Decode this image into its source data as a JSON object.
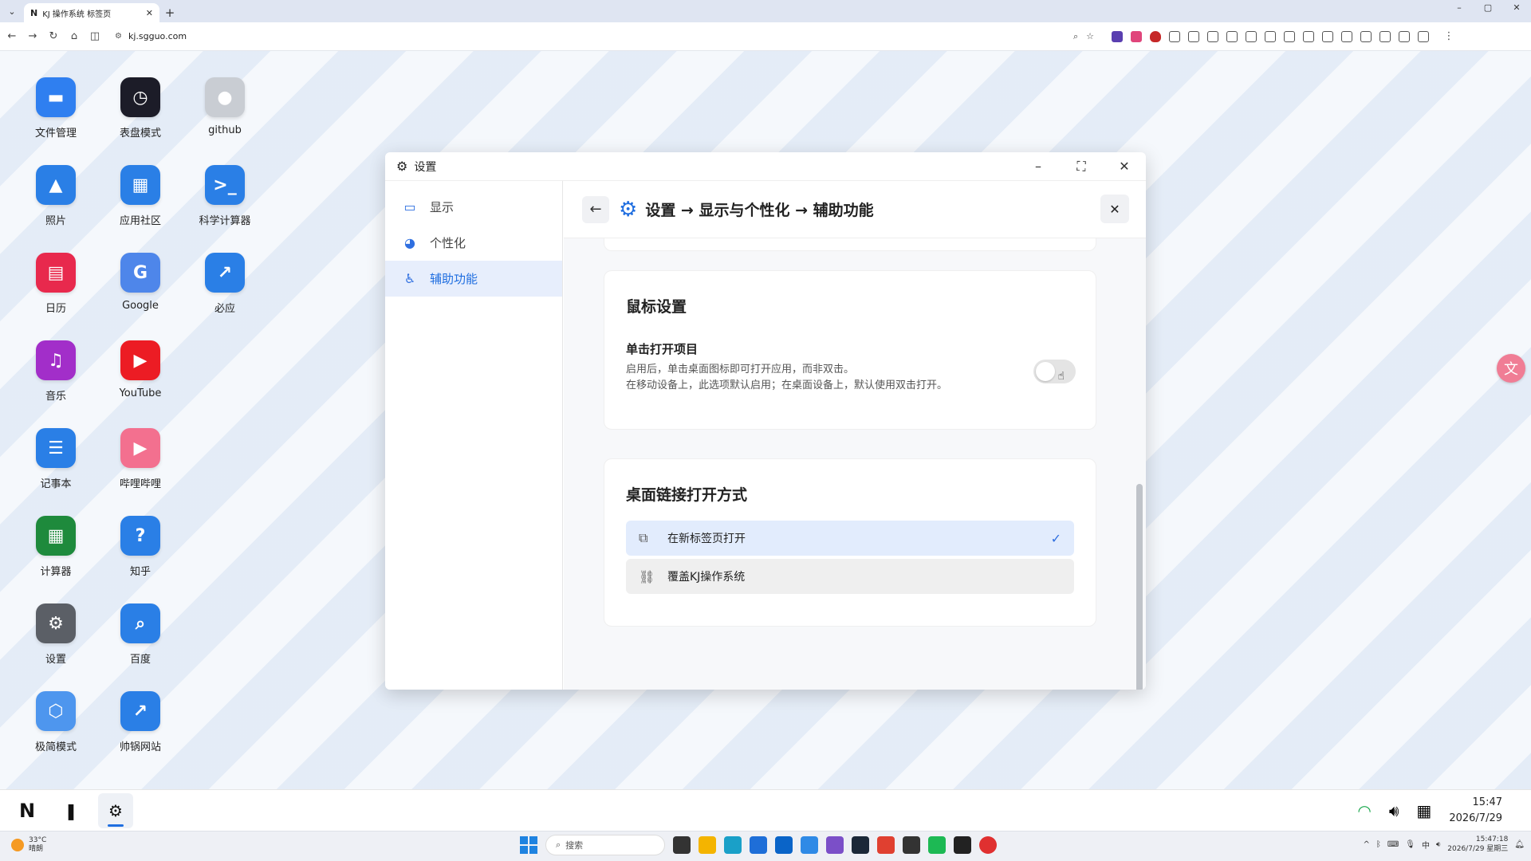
{
  "browser": {
    "tab_title": "KJ 操作系统 标签页",
    "tab_favicon": "N",
    "url": "kj.sgguo.com",
    "new_tab": "+",
    "win_min": "–",
    "win_max": "▢",
    "win_close": "✕"
  },
  "desktop_apps": [
    {
      "label": "文件管理",
      "icon": "folder-icon",
      "color": "#2f7ff0",
      "glyph": "▬"
    },
    {
      "label": "表盘模式",
      "icon": "clock-icon",
      "color": "#1c1c28",
      "glyph": "◷"
    },
    {
      "label": "github",
      "icon": "github-icon",
      "color": "#c9cdd3",
      "glyph": "●"
    },
    {
      "label": "照片",
      "icon": "photos-icon",
      "color": "#2a7fe6",
      "glyph": "▲"
    },
    {
      "label": "应用社区",
      "icon": "store-icon",
      "color": "#2a7fe6",
      "glyph": "▦"
    },
    {
      "label": "科学计算器",
      "icon": "terminal-icon",
      "color": "#2a7fe6",
      "glyph": ">_"
    },
    {
      "label": "日历",
      "icon": "calendar-icon",
      "color": "#e8294d",
      "glyph": "▤"
    },
    {
      "label": "Google",
      "icon": "google-icon",
      "color": "#4e86ea",
      "glyph": "G"
    },
    {
      "label": "必应",
      "icon": "external-link-icon",
      "color": "#2a7fe6",
      "glyph": "↗"
    },
    {
      "label": "音乐",
      "icon": "music-icon",
      "color": "#a22ec9",
      "glyph": "♫"
    },
    {
      "label": "YouTube",
      "icon": "youtube-icon",
      "color": "#ec1c24",
      "glyph": "▶"
    },
    {
      "label": "记事本",
      "icon": "notepad-icon",
      "color": "#2a7fe6",
      "glyph": "☰"
    },
    {
      "label": "哔哩哔哩",
      "icon": "bilibili-icon",
      "color": "#f3708f",
      "glyph": "▶"
    },
    {
      "label": "计算器",
      "icon": "calculator-icon",
      "color": "#1e8a3c",
      "glyph": "▦"
    },
    {
      "label": "知乎",
      "icon": "zhihu-icon",
      "color": "#2a7fe6",
      "glyph": "?"
    },
    {
      "label": "设置",
      "icon": "settings-icon",
      "color": "#5b5f66",
      "glyph": "⚙"
    },
    {
      "label": "百度",
      "icon": "search-icon",
      "color": "#2a7fe6",
      "glyph": "⌕"
    },
    {
      "label": "极简模式",
      "icon": "cube-icon",
      "color": "#4e96ee",
      "glyph": "⬡"
    },
    {
      "label": "帅锅网站",
      "icon": "external-link-icon",
      "color": "#2a7fe6",
      "glyph": "↗"
    }
  ],
  "settings": {
    "title": "设置",
    "sidebar": [
      {
        "label": "显示",
        "icon": "monitor-icon"
      },
      {
        "label": "个性化",
        "icon": "palette-icon"
      },
      {
        "label": "辅助功能",
        "icon": "accessibility-icon"
      }
    ],
    "breadcrumb": "设置 → 显示与个性化 → 辅助功能",
    "mouse_section": {
      "heading": "鼠标设置",
      "option_title": "单击打开项目",
      "desc_line1": "启用后，单击桌面图标即可打开应用，而非双击。",
      "desc_line2": "在移动设备上，此选项默认启用；在桌面设备上，默认使用双击打开。",
      "toggle_on": false
    },
    "link_section": {
      "heading": "桌面链接打开方式",
      "choices": [
        {
          "label": "在新标签页打开",
          "selected": true
        },
        {
          "label": "覆盖KJ操作系统",
          "selected": false
        }
      ]
    }
  },
  "dock": {
    "time": "15:47",
    "date": "2026/7/29"
  },
  "taskbar": {
    "temp": "33°C",
    "weather": "晴朗",
    "search_placeholder": "搜索",
    "tray_time": "15:47:18",
    "tray_date": "2026/7/29 星期三"
  }
}
